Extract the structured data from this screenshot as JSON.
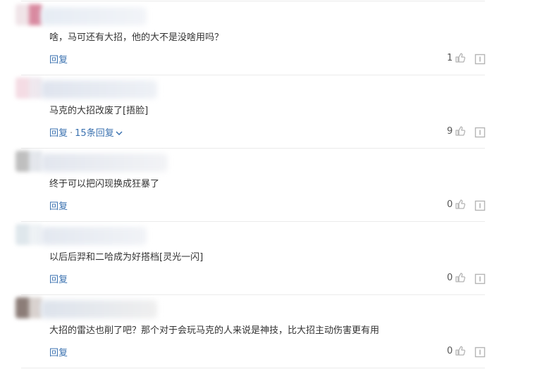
{
  "comments": [
    {
      "text": "啥，马可还有大招，他的大不是没啥用吗？",
      "reply_label": "回复",
      "replies_label": "",
      "likes": "1",
      "avatar_colors": [
        "#f0e4e8",
        "#d98aa0"
      ],
      "name_blur_colors": [
        "#e6ecf4",
        "#f2f4f8"
      ]
    },
    {
      "text": "马克的大招改废了[捂脸]",
      "reply_label": "回复",
      "replies_label": "15条回复",
      "likes": "9",
      "avatar_colors": [
        "#f4dce4",
        "#efe8ee"
      ],
      "name_blur_colors": [
        "#dfe4ee",
        "#eef1f6"
      ]
    },
    {
      "text": "终于可以把闪现换成狂暴了",
      "reply_label": "回复",
      "replies_label": "",
      "likes": "0",
      "avatar_colors": [
        "#bfbfbf",
        "#e4e7ec"
      ],
      "name_blur_colors": [
        "#e2e6ee",
        "#f2f3f6"
      ]
    },
    {
      "text": "以后后羿和二哈成为好搭档[灵光一闪]",
      "reply_label": "回复",
      "replies_label": "",
      "likes": "0",
      "avatar_colors": [
        "#dfe7ec",
        "#eef2f5"
      ],
      "name_blur_colors": [
        "#e3e8f0",
        "#f1f3f7"
      ]
    },
    {
      "text": "大招的雷达也削了吧？那个对于会玩马克的人来说是神技，比大招主动伤害更有用",
      "reply_label": "回复",
      "replies_label": "",
      "likes": "0",
      "avatar_colors": [
        "#8c7d78",
        "#d9d2cf"
      ],
      "name_blur_colors": [
        "#dde3ec",
        "#efefef"
      ]
    }
  ],
  "icons": {
    "like": "thumbs-up-icon",
    "report": "report-icon",
    "expand": "chevron-down-icon"
  },
  "colors": {
    "link": "#3b72b0",
    "text": "#333333",
    "icon": "#b5b5b5"
  }
}
